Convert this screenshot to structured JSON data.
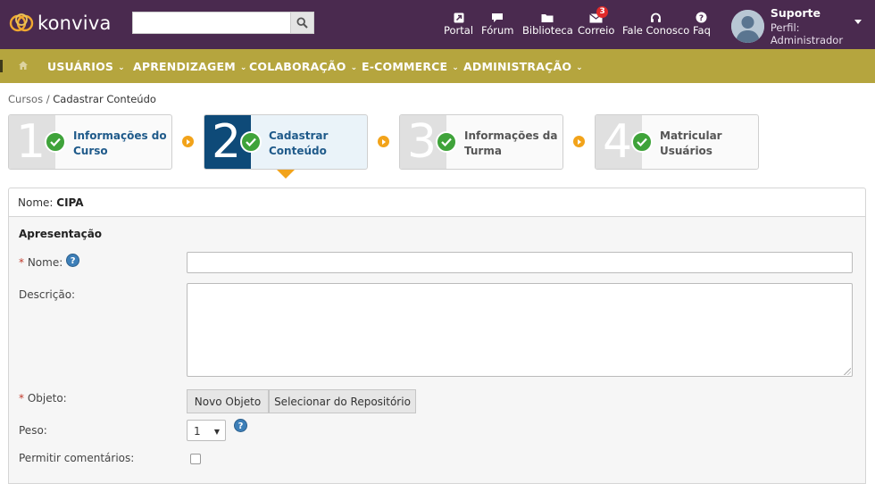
{
  "header": {
    "logo_text": "konviva",
    "search": {
      "placeholder": "",
      "value": ""
    },
    "nav": [
      {
        "label": "Portal",
        "icon": "external-link-icon"
      },
      {
        "label": "Fórum",
        "icon": "chat-bubble-icon"
      },
      {
        "label": "Biblioteca",
        "icon": "folder-icon"
      },
      {
        "label": "Correio",
        "icon": "envelope-icon",
        "badge": "3"
      },
      {
        "label": "Fale Conosco",
        "icon": "headset-icon"
      },
      {
        "label": "Faq",
        "icon": "question-circle-icon"
      }
    ],
    "user": {
      "name": "Suporte",
      "role": "Perfil: Administrador"
    }
  },
  "menu": {
    "items": [
      "USUÁRIOS",
      "APRENDIZAGEM",
      "COLABORAÇÃO",
      "E-COMMERCE",
      "ADMINISTRAÇÃO"
    ]
  },
  "breadcrumb": {
    "parent": "Cursos",
    "separator": "/",
    "current": "Cadastrar Conteúdo"
  },
  "steps": [
    {
      "number": "1",
      "line1": "Informações do",
      "line2": "Curso",
      "state": "done"
    },
    {
      "number": "2",
      "line1": "Cadastrar",
      "line2": "Conteúdo",
      "state": "active"
    },
    {
      "number": "3",
      "line1": "Informações da",
      "line2": "Turma",
      "state": "pending"
    },
    {
      "number": "4",
      "line1": "Matricular",
      "line2": "Usuários",
      "state": "pending"
    }
  ],
  "course": {
    "label": "Nome:",
    "value": "CIPA"
  },
  "form": {
    "section_title": "Apresentação",
    "required_mark": "*",
    "name_label": "Nome:",
    "name_value": "",
    "help_symbol": "?",
    "description_label": "Descrição:",
    "description_value": "",
    "object_label": "Objeto:",
    "new_object_button": "Novo Objeto",
    "select_repo_button": "Selecionar do Repositório",
    "weight_label": "Peso:",
    "weight_value": "1",
    "comments_label": "Permitir comentários:",
    "comments_checked": false
  },
  "colors": {
    "header_bg": "#4a2a4f",
    "menubar_bg": "#b5a53e",
    "step_active": "#0e4a78",
    "check_green": "#3fa33a",
    "arrow_orange": "#f2a31a",
    "badge_red": "#e02a2a"
  }
}
